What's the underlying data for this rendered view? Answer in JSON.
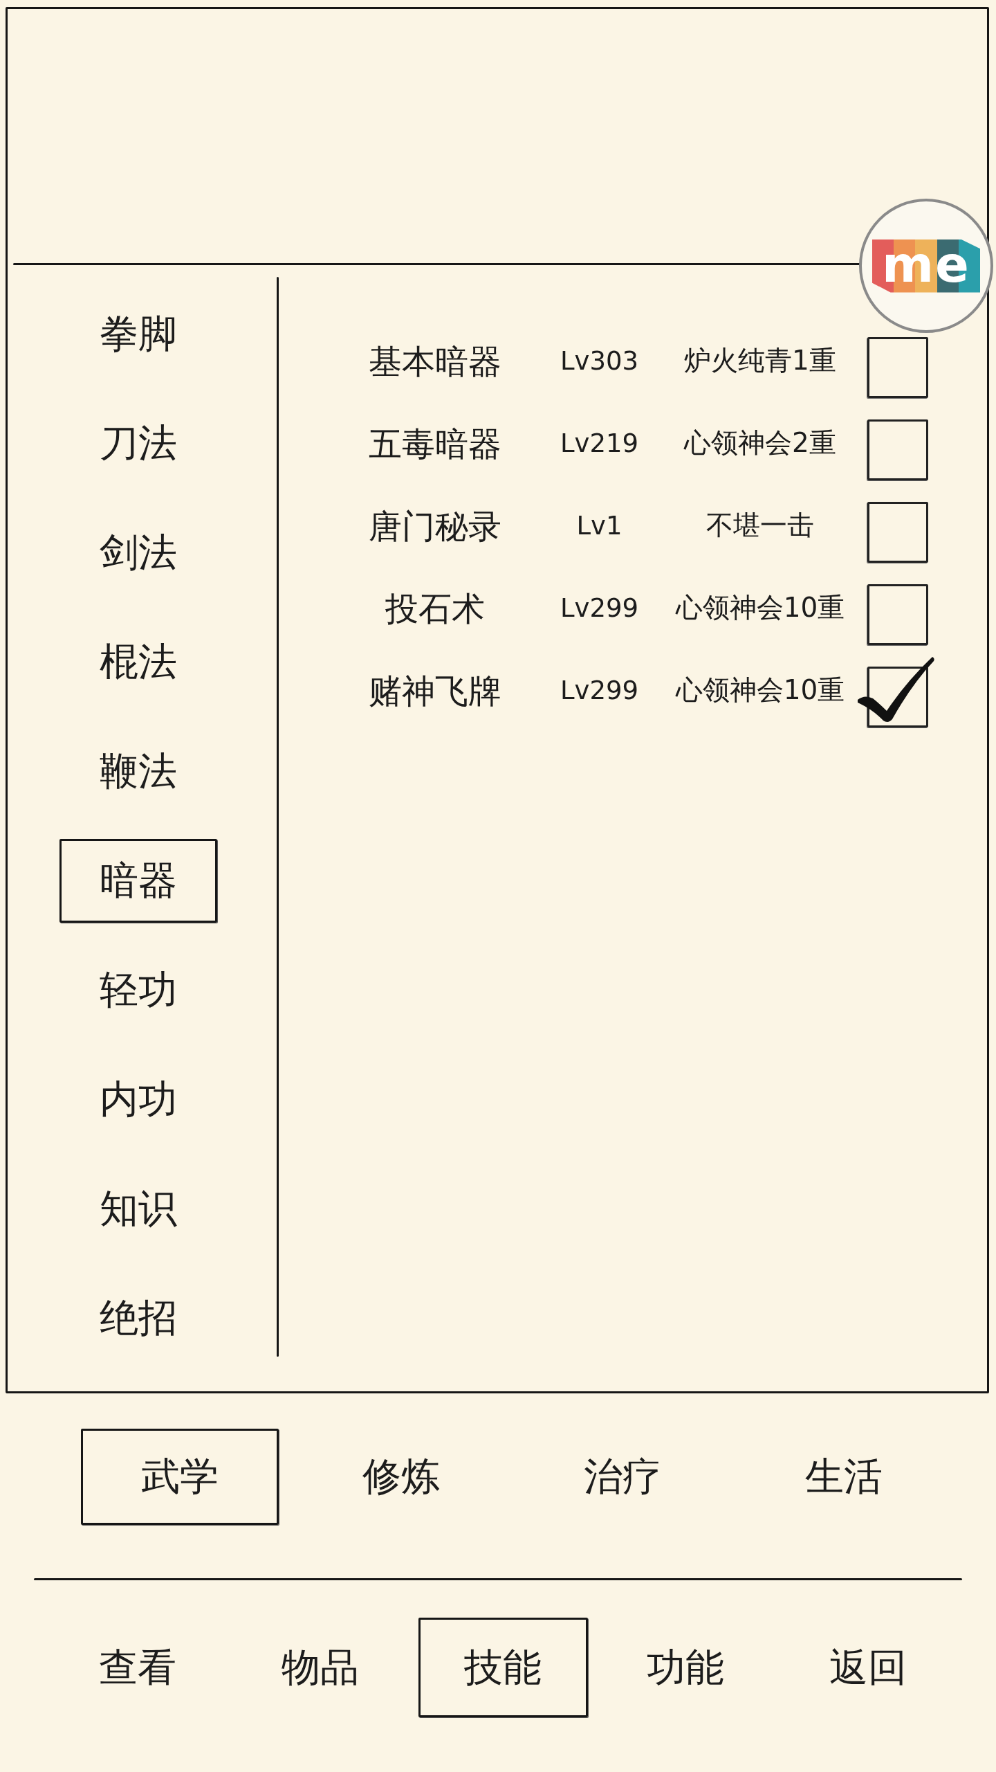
{
  "floating_button": {
    "label": "me"
  },
  "categories": [
    {
      "label": "拳脚",
      "selected": false
    },
    {
      "label": "刀法",
      "selected": false
    },
    {
      "label": "剑法",
      "selected": false
    },
    {
      "label": "棍法",
      "selected": false
    },
    {
      "label": "鞭法",
      "selected": false
    },
    {
      "label": "暗器",
      "selected": true
    },
    {
      "label": "轻功",
      "selected": false
    },
    {
      "label": "内功",
      "selected": false
    },
    {
      "label": "知识",
      "selected": false
    },
    {
      "label": "绝招",
      "selected": false
    }
  ],
  "skills": [
    {
      "name": "基本暗器",
      "lv": "Lv303",
      "rank": "炉火纯青1重",
      "checked": false
    },
    {
      "name": "五毒暗器",
      "lv": "Lv219",
      "rank": "心领神会2重",
      "checked": false
    },
    {
      "name": "唐门秘录",
      "lv": "Lv1",
      "rank": "不堪一击",
      "checked": false
    },
    {
      "name": "投石术",
      "lv": "Lv299",
      "rank": "心领神会10重",
      "checked": false
    },
    {
      "name": "赌神飞牌",
      "lv": "Lv299",
      "rank": "心领神会10重",
      "checked": true
    }
  ],
  "skill_types": [
    {
      "label": "武学",
      "selected": true
    },
    {
      "label": "修炼",
      "selected": false
    },
    {
      "label": "治疗",
      "selected": false
    },
    {
      "label": "生活",
      "selected": false
    }
  ],
  "nav_tabs": [
    {
      "label": "查看",
      "selected": false
    },
    {
      "label": "物品",
      "selected": false
    },
    {
      "label": "技能",
      "selected": true
    },
    {
      "label": "功能",
      "selected": false
    },
    {
      "label": "返回",
      "selected": false
    }
  ]
}
